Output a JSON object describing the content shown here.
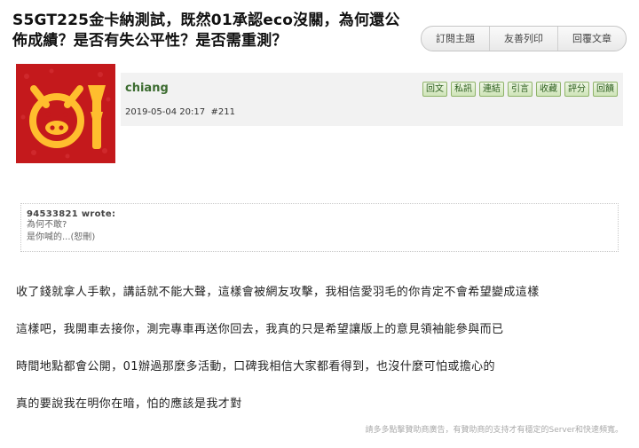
{
  "thread": {
    "title": "S5GT225金卡納測試，既然01承認eco沒關，為何還公佈成績？是否有失公平性？是否需重測？"
  },
  "toolbar": {
    "subscribe": "訂閱主題",
    "print": "友善列印",
    "reply": "回覆文章"
  },
  "post": {
    "username": "chiang",
    "datetime": "2019-05-04 20:17",
    "floor": "#211",
    "actions": [
      "回文",
      "私訊",
      "連結",
      "引言",
      "收藏",
      "評分",
      "回饋"
    ]
  },
  "quote": {
    "header": "94533821 wrote:",
    "line1": "為何不敢?",
    "line2": "是你喊的...(恕刪)"
  },
  "body": [
    "收了錢就拿人手軟，講話就不能大聲，這樣會被網友攻擊，我相信愛羽毛的你肯定不會希望變成這樣",
    "這樣吧，我開車去接你，測完專車再送你回去，我真的只是希望讓版上的意見領袖能參與而已",
    "時間地點都會公開，01辦過那麼多活動，口碑我相信大家都看得到，也沒什麼可怕或擔心的",
    "真的要說我在明你在暗，怕的應該是我才對"
  ],
  "sponsor": "請多多點擊贊助商廣告，有贊助商的支持才有穩定的Server和快速頻寬。"
}
